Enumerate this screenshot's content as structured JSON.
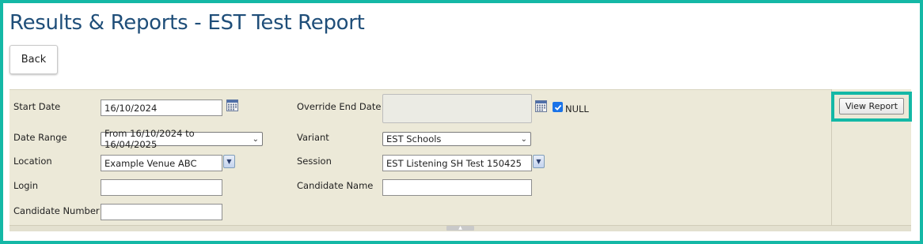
{
  "page": {
    "title": "Results & Reports - EST Test Report",
    "back_label": "Back"
  },
  "form": {
    "start_date": {
      "label": "Start Date",
      "value": "16/10/2024"
    },
    "override_end_date": {
      "label": "Override End Date",
      "value": "",
      "null_label": "NULL",
      "null_checked": true
    },
    "date_range": {
      "label": "Date Range",
      "value": "From 16/10/2024 to 16/04/2025"
    },
    "variant": {
      "label": "Variant",
      "value": "EST Schools"
    },
    "location": {
      "label": "Location",
      "value": "Example Venue ABC"
    },
    "session": {
      "label": "Session",
      "value": "EST Listening SH Test 150425"
    },
    "login": {
      "label": "Login",
      "value": ""
    },
    "candidate_name": {
      "label": "Candidate Name",
      "value": ""
    },
    "candidate_number": {
      "label": "Candidate Number",
      "value": ""
    }
  },
  "actions": {
    "view_report_label": "View Report"
  },
  "colors": {
    "title": "#1f4e79",
    "panel_bg": "#ece9d8",
    "highlight": "#14b8a6",
    "checkbox": "#1a73e8"
  },
  "icons": [
    "calendar-icon",
    "dropdown-arrow-icon",
    "checkmark-icon",
    "collapse-arrow-icon"
  ]
}
